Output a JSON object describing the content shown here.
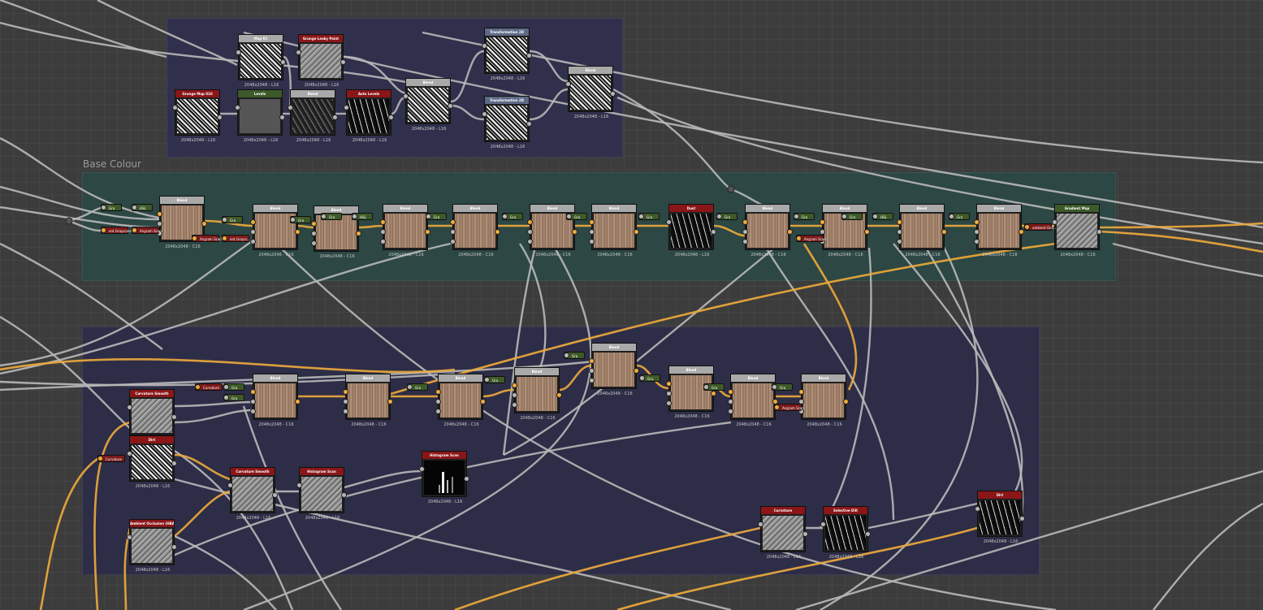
{
  "frames": [
    {
      "id": "f-top",
      "title": "",
      "color": "#30304d"
    },
    {
      "id": "f-base",
      "title": "Base Colour",
      "color": "#2c4744"
    },
    {
      "id": "f-bottom",
      "title": "",
      "color": "#2d2d47"
    }
  ],
  "colors": {
    "wire_gray": "#b9b9b9",
    "wire_orange": "#f0ab3b",
    "head_gray": "#a9a9a9",
    "head_red": "#8a1618",
    "head_green": "#3c5a2a",
    "head_blue": "#5d6a86"
  },
  "nodes": [
    {
      "label": "Grunge Map 010",
      "head": "red",
      "size": "2048x2048 - L16",
      "tex": "bw"
    },
    {
      "label": "Levels",
      "head": "green",
      "size": "2048x2048 - L16",
      "tex": "grayflat"
    },
    {
      "label": "Blend",
      "head": "gray",
      "size": "2048x2048 - L16",
      "tex": "dark"
    },
    {
      "label": "Auto Levels",
      "head": "red",
      "size": "2048x2048 - L16",
      "tex": "dots"
    },
    {
      "label": "Map 01",
      "head": "gray",
      "size": "2048x2048 - L16",
      "tex": "bw"
    },
    {
      "label": "Grunge Leaky Paint",
      "head": "red",
      "size": "2048x2048 - L16",
      "tex": "gray"
    },
    {
      "label": "Blend",
      "head": "gray",
      "size": "2048x2048 - L16",
      "tex": "bw"
    },
    {
      "label": "Transformation 2D",
      "head": "blue",
      "size": "2048x2048 - L16",
      "tex": "bw"
    },
    {
      "label": "Transformation 2D",
      "head": "blue",
      "size": "2048x2048 - L16",
      "tex": "bw"
    },
    {
      "label": "Blend",
      "head": "gray",
      "size": "2048x2048 - L16",
      "tex": "bw"
    },
    {
      "label": "Blend",
      "head": "gray",
      "size": "2048x2048 - C16",
      "tex": "wood"
    },
    {
      "label": "Blend",
      "head": "gray",
      "size": "2048x2048 - C16",
      "tex": "wood"
    },
    {
      "label": "Blend",
      "head": "gray",
      "size": "2048x2048 - C16",
      "tex": "wood"
    },
    {
      "label": "Blend",
      "head": "gray",
      "size": "2048x2048 - C16",
      "tex": "wood"
    },
    {
      "label": "Blend",
      "head": "gray",
      "size": "2048x2048 - C16",
      "tex": "wood"
    },
    {
      "label": "Blend",
      "head": "gray",
      "size": "2048x2048 - C16",
      "tex": "wood"
    },
    {
      "label": "Blend",
      "head": "gray",
      "size": "2048x2048 - C16",
      "tex": "wood"
    },
    {
      "label": "Dust",
      "head": "red",
      "size": "2048x2048 - L16",
      "tex": "dots"
    },
    {
      "label": "Blend",
      "head": "gray",
      "size": "2048x2048 - C16",
      "tex": "wood"
    },
    {
      "label": "Blend",
      "head": "gray",
      "size": "2048x2048 - C16",
      "tex": "wood"
    },
    {
      "label": "Blend",
      "head": "gray",
      "size": "2048x2048 - C16",
      "tex": "wood"
    },
    {
      "label": "Blend",
      "head": "gray",
      "size": "2048x2048 - C16",
      "tex": "wood"
    },
    {
      "label": "Gradient Map",
      "head": "green",
      "size": "2048x2048 - C16",
      "tex": "gray"
    },
    {
      "label": "Curvature Smooth",
      "head": "red",
      "size": "",
      "tex": "gray"
    },
    {
      "label": "Dirt",
      "head": "red",
      "size": "2048x2048 - L16",
      "tex": "bw"
    },
    {
      "label": "Ambient Occlusion (HBAO)",
      "head": "red",
      "size": "2048x2048 - L16",
      "tex": "gray"
    },
    {
      "label": "Blend",
      "head": "gray",
      "size": "2048x2048 - C16",
      "tex": "wood"
    },
    {
      "label": "Blend",
      "head": "gray",
      "size": "2048x2048 - C16",
      "tex": "wood"
    },
    {
      "label": "Blend",
      "head": "gray",
      "size": "2048x2048 - C16",
      "tex": "wood"
    },
    {
      "label": "Blend",
      "head": "gray",
      "size": "2048x2048 - C16",
      "tex": "wood"
    },
    {
      "label": "Blend",
      "head": "gray",
      "size": "2048x2048 - C16",
      "tex": "wood"
    },
    {
      "label": "Blend",
      "head": "gray",
      "size": "2048x2048 - C16",
      "tex": "wood"
    },
    {
      "label": "Blend",
      "head": "gray",
      "size": "2048x2048 - C16",
      "tex": "wood"
    },
    {
      "label": "Blend",
      "head": "gray",
      "size": "2048x2048 - C16",
      "tex": "wood"
    },
    {
      "label": "Curvature Smooth",
      "head": "red",
      "size": "2048x2048 - L16",
      "tex": "gray"
    },
    {
      "label": "Histogram Scan",
      "head": "red",
      "size": "2048x2048 - L16",
      "tex": "gray"
    },
    {
      "label": "Histogram Scan",
      "head": "red",
      "size": "2048x2048 - L16",
      "tex": "hist"
    },
    {
      "label": "Curvature",
      "head": "red",
      "size": "2048x2048 - L16",
      "tex": "gray"
    },
    {
      "label": "Selective Dilt",
      "head": "red",
      "size": "2048x2048 - L16",
      "tex": "dots"
    },
    {
      "label": "Dirt",
      "head": "red",
      "size": "2048x2048 - L16",
      "tex": "dots"
    }
  ],
  "pills": [
    {
      "label": "Gra",
      "style": "green"
    },
    {
      "label": "HSL",
      "style": "green"
    },
    {
      "label": "ent Grayscale",
      "style": "red"
    },
    {
      "label": "Angram Scan",
      "style": "red"
    },
    {
      "label": "Gra",
      "style": "green"
    },
    {
      "label": "Angram Scan",
      "style": "red"
    },
    {
      "label": "ent Graysc...",
      "style": "red"
    },
    {
      "label": "Gra",
      "style": "green"
    },
    {
      "label": "Gra",
      "style": "green"
    },
    {
      "label": "HSL",
      "style": "green"
    },
    {
      "label": "Gra",
      "style": "green"
    },
    {
      "label": "Gra",
      "style": "green"
    },
    {
      "label": "Gra",
      "style": "green"
    },
    {
      "label": "Gra",
      "style": "green"
    },
    {
      "label": "Gra",
      "style": "green"
    },
    {
      "label": "Gra",
      "style": "green"
    },
    {
      "label": "Angram Scan",
      "style": "red"
    },
    {
      "label": "Gra",
      "style": "green"
    },
    {
      "label": "HSL",
      "style": "green"
    },
    {
      "label": "Gra",
      "style": "green"
    },
    {
      "label": "ambient Occl...",
      "style": "red"
    },
    {
      "label": "Curvature",
      "style": "red"
    },
    {
      "label": "Gra",
      "style": "green"
    },
    {
      "label": "Gra",
      "style": "green"
    },
    {
      "label": "Gra",
      "style": "green"
    },
    {
      "label": "Gra",
      "style": "green"
    },
    {
      "label": "Gra",
      "style": "green"
    },
    {
      "label": "Gra",
      "style": "green"
    },
    {
      "label": "Gra",
      "style": "green"
    },
    {
      "label": "Gra",
      "style": "green"
    },
    {
      "label": "Angram Scan",
      "style": "red"
    },
    {
      "label": "Curvature",
      "style": "red"
    }
  ]
}
